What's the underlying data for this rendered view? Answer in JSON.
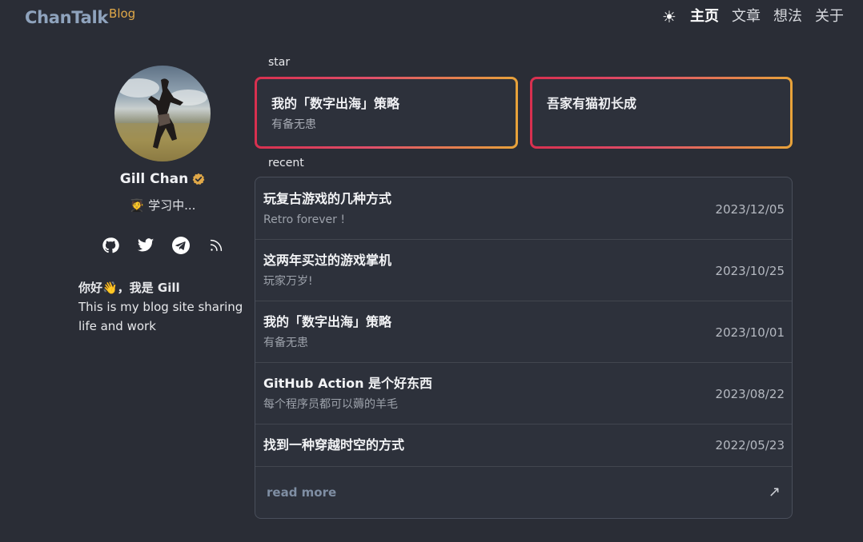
{
  "header": {
    "logo_main": "ChanTalk",
    "logo_sup": "Blog",
    "theme_icon": "sun-icon",
    "nav": [
      "主页",
      "文章",
      "想法",
      "关于"
    ]
  },
  "profile": {
    "name": "Gill Chan",
    "status_emoji": "🧑‍🎓",
    "status": "学习中...",
    "socials": [
      "github-icon",
      "twitter-icon",
      "telegram-icon",
      "rss-icon"
    ],
    "bio_greeting": "你好👋，我是 Gill",
    "bio_text": "This is my blog site sharing life and work"
  },
  "star": {
    "label": "star",
    "cards": [
      {
        "title": "我的「数字出海」策略",
        "subtitle": "有备无患"
      },
      {
        "title": "吾家有猫初长成",
        "subtitle": ""
      }
    ]
  },
  "recent": {
    "label": "recent",
    "posts": [
      {
        "title": "玩复古游戏的几种方式",
        "subtitle": "Retro forever !",
        "date": "2023/12/05"
      },
      {
        "title": "这两年买过的游戏掌机",
        "subtitle": "玩家万岁!",
        "date": "2023/10/25"
      },
      {
        "title": "我的「数字出海」策略",
        "subtitle": "有备无患",
        "date": "2023/10/01"
      },
      {
        "title": "GitHub Action 是个好东西",
        "subtitle": "每个程序员都可以薅的羊毛",
        "date": "2023/08/22"
      },
      {
        "title": "找到一种穿越时空的方式",
        "subtitle": "",
        "date": "2022/05/23"
      }
    ],
    "read_more": "read more",
    "read_more_icon": "↗"
  },
  "colors": {
    "background": "#2a2d36",
    "logo": "#8fa3bd",
    "logo_sup": "#e0a848",
    "card_gradient_start": "#d8304f",
    "card_gradient_end": "#e8a33a",
    "read_more": "#7f8ea3"
  }
}
